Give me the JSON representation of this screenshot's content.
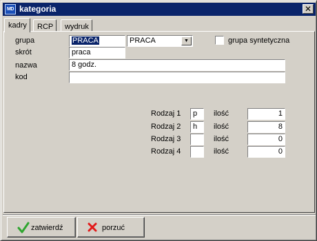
{
  "window": {
    "title": "kategoria",
    "icon": "app-icon",
    "icon_text": "MD",
    "close_glyph": "✕"
  },
  "tabs": [
    {
      "label": "kadry",
      "active": true
    },
    {
      "label": "RCP",
      "active": false
    },
    {
      "label": "wydruk",
      "active": false
    }
  ],
  "form": {
    "grupa": {
      "label": "grupa",
      "value": "PRACA",
      "combo_value": "PRACA"
    },
    "grupa_syntetyczna": {
      "label": "grupa syntetyczna",
      "checked": false
    },
    "skrot": {
      "label": "skrót",
      "value": "praca"
    },
    "nazwa": {
      "label": "nazwa",
      "value": "8 godz."
    },
    "kod": {
      "label": "kod",
      "value": ""
    }
  },
  "rodzaje": [
    {
      "label": "Rodzaj 1",
      "code": "p",
      "qty_label": "ilość",
      "qty": "1"
    },
    {
      "label": "Rodzaj 2",
      "code": "h",
      "qty_label": "ilość",
      "qty": "8"
    },
    {
      "label": "Rodzaj 3",
      "code": "",
      "qty_label": "ilość",
      "qty": "0"
    },
    {
      "label": "Rodzaj 4",
      "code": "",
      "qty_label": "ilość",
      "qty": "0"
    }
  ],
  "buttons": {
    "confirm_label": "zatwierdź",
    "confirm_icon": "check-icon",
    "confirm_color": "#2fa52f",
    "cancel_label": "porzuć",
    "cancel_icon": "cross-icon",
    "cancel_color": "#e21a1a"
  },
  "colors": {
    "titlebar": "#0a246a",
    "window": "#d4d0c8"
  }
}
